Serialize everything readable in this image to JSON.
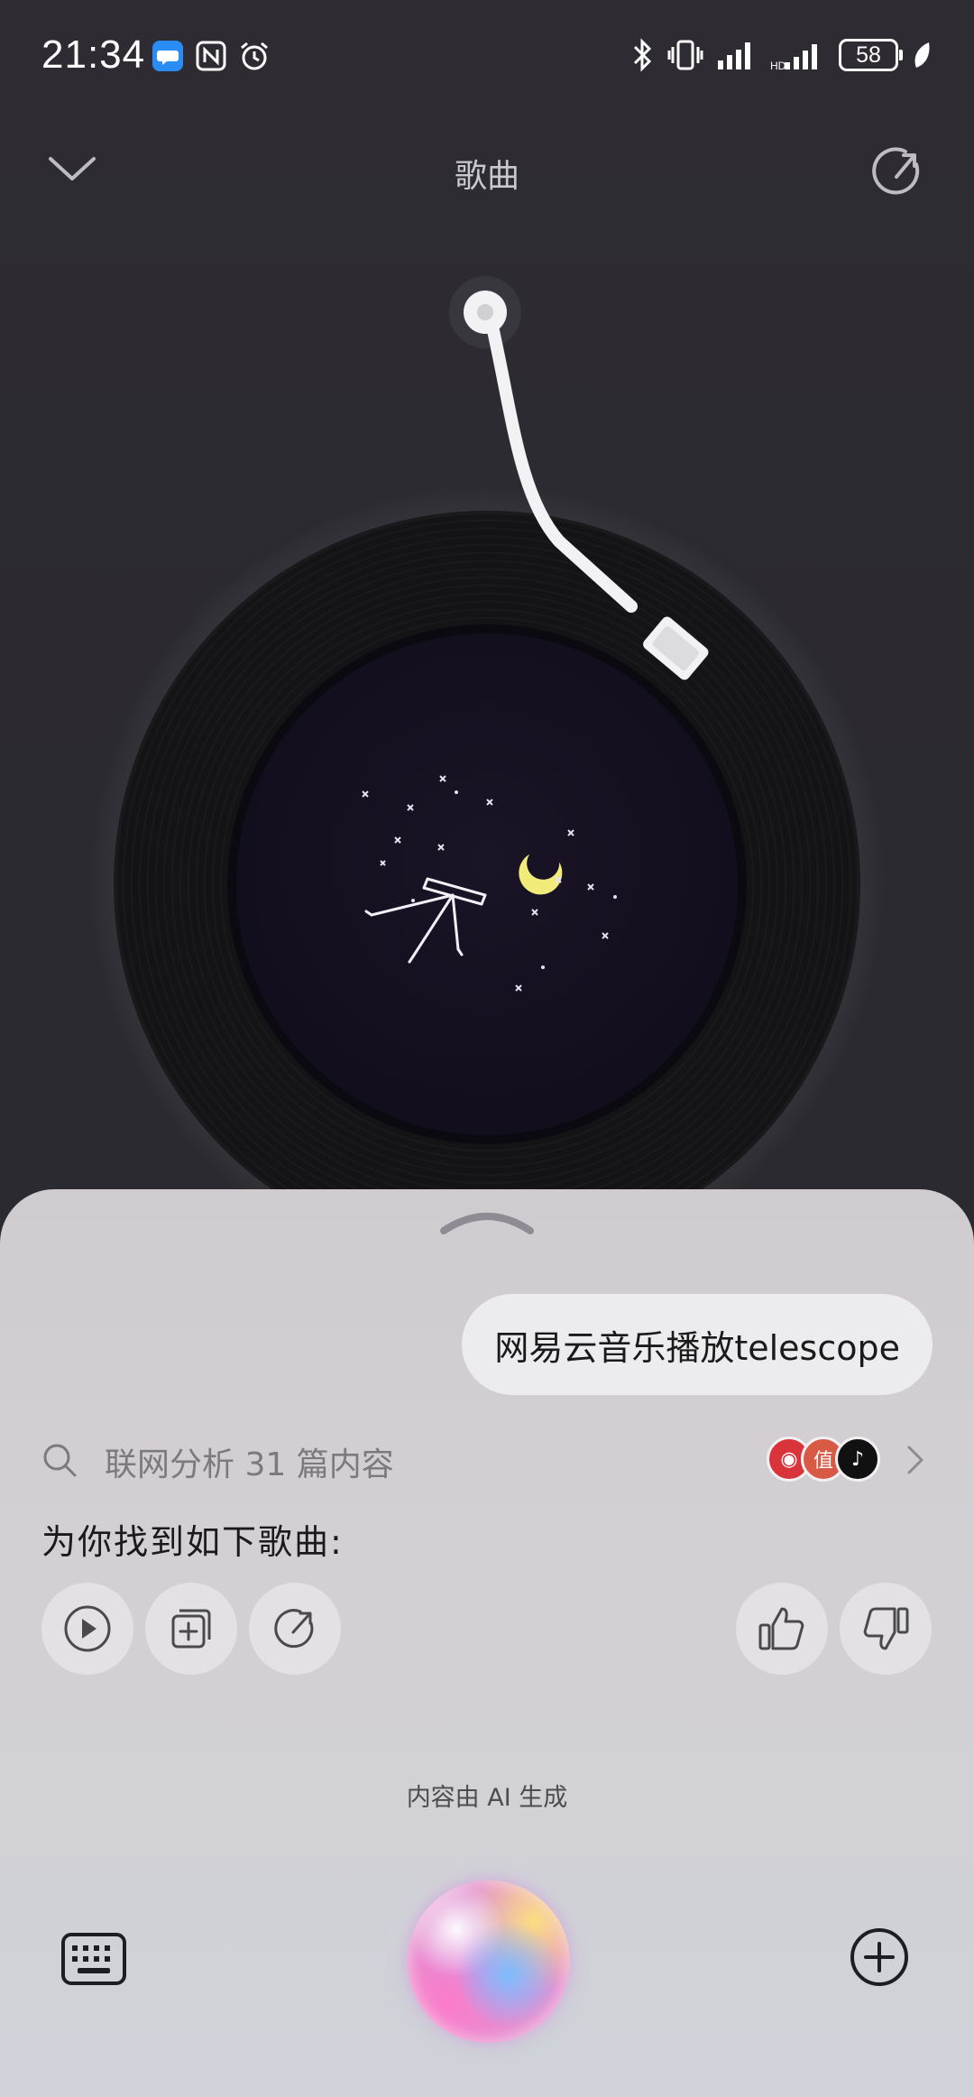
{
  "status_bar": {
    "time": "21:34",
    "battery": "58",
    "icons": [
      "message-icon",
      "nfc-icon",
      "alarm-icon",
      "bluetooth-icon",
      "vibrate-icon",
      "signal-icon",
      "signal-2-icon",
      "battery-icon",
      "leaf-icon"
    ]
  },
  "header": {
    "title": "歌曲",
    "collapse_icon": "chevron-down-icon",
    "refresh_icon": "refresh-icon"
  },
  "player": {
    "artwork_icon": "telescope-night-sky"
  },
  "sheet": {
    "user_message": "网易云音乐播放telescope",
    "search_summary": "联网分析 31 篇内容",
    "sources": [
      {
        "name": "weibo",
        "color": "#d9343b",
        "glyph": "◉"
      },
      {
        "name": "zhihu",
        "color": "#d85a45",
        "glyph": "值"
      },
      {
        "name": "tiktok",
        "color": "#111111",
        "glyph": "♪"
      }
    ],
    "result_text": "为你找到如下歌曲:",
    "actions": [
      "play-icon",
      "add-to-playlist-icon",
      "share-icon"
    ],
    "feedback": [
      "thumbs-up-icon",
      "thumbs-down-icon"
    ],
    "ai_note": "内容由 AI 生成",
    "input_icons": [
      "keyboard-icon",
      "voice-orb",
      "plus-icon"
    ]
  },
  "colors": {
    "background": "#2e2c32",
    "sheet": "#d3d0d4",
    "bubble": "#ecebed",
    "moon": "#f1eb7a"
  }
}
